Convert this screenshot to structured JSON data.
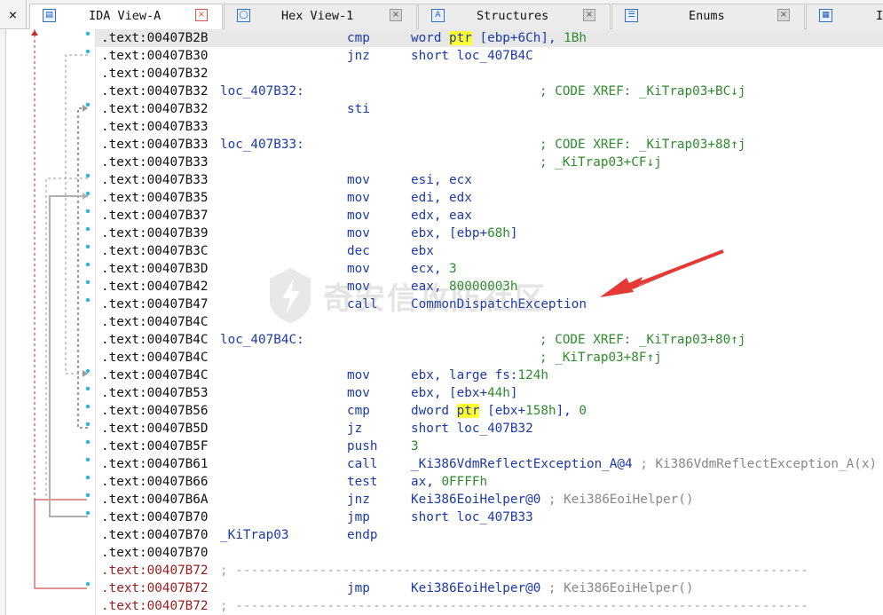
{
  "tabs": [
    {
      "label": "IDA View-A",
      "icon": "ida-view-icon",
      "active": true
    },
    {
      "label": "Hex View-1",
      "icon": "hex-view-icon",
      "active": false
    },
    {
      "label": "Structures",
      "icon": "structures-icon",
      "active": false
    },
    {
      "label": "Enums",
      "icon": "enums-icon",
      "active": false
    },
    {
      "label": "I",
      "icon": "imports-icon",
      "active": false
    }
  ],
  "close_glyph": "×",
  "tab_close_glyph": "×",
  "lines": [
    {
      "addr": ".text:00407B2B",
      "mn": "cmp",
      "op": [
        [
          "word ",
          ""
        ],
        [
          "ptr",
          "hl"
        ],
        [
          " [ebp+6Ch], ",
          ""
        ],
        [
          "1Bh",
          "num"
        ]
      ],
      "sel": true
    },
    {
      "addr": ".text:00407B30",
      "mn": "jnz",
      "op": [
        [
          "short loc_407B4C",
          ""
        ]
      ]
    },
    {
      "addr": ".text:00407B32"
    },
    {
      "addr": ".text:00407B32",
      "label": "loc_407B32:",
      "comment": "; CODE XREF: _KiTrap03+BC↓j"
    },
    {
      "addr": ".text:00407B32",
      "mn": "sti"
    },
    {
      "addr": ".text:00407B33"
    },
    {
      "addr": ".text:00407B33",
      "label": "loc_407B33:",
      "comment": "; CODE XREF: _KiTrap03+88↑j"
    },
    {
      "addr": ".text:00407B33",
      "comment": "; _KiTrap03+CF↓j"
    },
    {
      "addr": ".text:00407B33",
      "mn": "mov",
      "op": [
        [
          "esi, ecx",
          ""
        ]
      ]
    },
    {
      "addr": ".text:00407B35",
      "mn": "mov",
      "op": [
        [
          "edi, edx",
          ""
        ]
      ]
    },
    {
      "addr": ".text:00407B37",
      "mn": "mov",
      "op": [
        [
          "edx, eax",
          ""
        ]
      ]
    },
    {
      "addr": ".text:00407B39",
      "mn": "mov",
      "op": [
        [
          "ebx, [ebp+",
          ""
        ],
        [
          "68h",
          "num"
        ],
        [
          "]",
          ""
        ]
      ]
    },
    {
      "addr": ".text:00407B3C",
      "mn": "dec",
      "op": [
        [
          "ebx",
          ""
        ]
      ]
    },
    {
      "addr": ".text:00407B3D",
      "mn": "mov",
      "op": [
        [
          "ecx, ",
          ""
        ],
        [
          "3",
          "num"
        ]
      ]
    },
    {
      "addr": ".text:00407B42",
      "mn": "mov",
      "op": [
        [
          "eax, ",
          ""
        ],
        [
          "80000003h",
          "num"
        ]
      ]
    },
    {
      "addr": ".text:00407B47",
      "mn": "call",
      "op": [
        [
          "CommonDispatchException",
          ""
        ]
      ]
    },
    {
      "addr": ".text:00407B4C"
    },
    {
      "addr": ".text:00407B4C",
      "label": "loc_407B4C:",
      "comment": "; CODE XREF: _KiTrap03+80↑j"
    },
    {
      "addr": ".text:00407B4C",
      "comment": "; _KiTrap03+8F↑j"
    },
    {
      "addr": ".text:00407B4C",
      "mn": "mov",
      "op": [
        [
          "ebx, large fs:",
          ""
        ],
        [
          "124h",
          "num"
        ]
      ]
    },
    {
      "addr": ".text:00407B53",
      "mn": "mov",
      "op": [
        [
          "ebx, [ebx+",
          ""
        ],
        [
          "44h",
          "num"
        ],
        [
          "]",
          ""
        ]
      ]
    },
    {
      "addr": ".text:00407B56",
      "mn": "cmp",
      "op": [
        [
          "dword ",
          ""
        ],
        [
          "ptr",
          "hl"
        ],
        [
          " [ebx+",
          ""
        ],
        [
          "158h",
          "num"
        ],
        [
          "], ",
          ""
        ],
        [
          "0",
          "num"
        ]
      ]
    },
    {
      "addr": ".text:00407B5D",
      "mn": "jz",
      "op": [
        [
          "short loc_407B32",
          ""
        ]
      ]
    },
    {
      "addr": ".text:00407B5F",
      "mn": "push",
      "op": [
        [
          "3",
          "num"
        ]
      ]
    },
    {
      "addr": ".text:00407B61",
      "mn": "call",
      "op": [
        [
          "_Ki386VdmReflectException_A@4",
          ""
        ],
        [
          " ; Ki386VdmReflectException_A(x)",
          "gray"
        ]
      ]
    },
    {
      "addr": ".text:00407B66",
      "mn": "test",
      "op": [
        [
          "ax, ",
          ""
        ],
        [
          "0FFFFh",
          "num"
        ]
      ]
    },
    {
      "addr": ".text:00407B6A",
      "mn": "jnz",
      "op": [
        [
          "Kei386EoiHelper@0",
          ""
        ],
        [
          " ; Kei386EoiHelper()",
          "gray"
        ]
      ]
    },
    {
      "addr": ".text:00407B70",
      "mn": "jmp",
      "op": [
        [
          "short loc_407B33",
          ""
        ]
      ]
    },
    {
      "addr": ".text:00407B70",
      "label": "_KiTrap03",
      "mn": "endp"
    },
    {
      "addr": ".text:00407B70"
    },
    {
      "addr": ".text:00407B72",
      "red": true,
      "sep": "; ---------------------------------------------------------------------------"
    },
    {
      "addr": ".text:00407B72",
      "red": true,
      "mn": "jmp",
      "op": [
        [
          "Kei386EoiHelper@0",
          ""
        ],
        [
          " ; Kei386EoiHelper()",
          "gray"
        ]
      ]
    },
    {
      "addr": ".text:00407B72",
      "red": true,
      "sep": "; ---------------------------------------------------------------------------"
    }
  ],
  "watermark": "奇安信攻防社区",
  "colors": {
    "accent": "#1c3aa9",
    "comment": "#2e8b2e",
    "highlight": "#ffff33",
    "arrow": "#e53935"
  }
}
